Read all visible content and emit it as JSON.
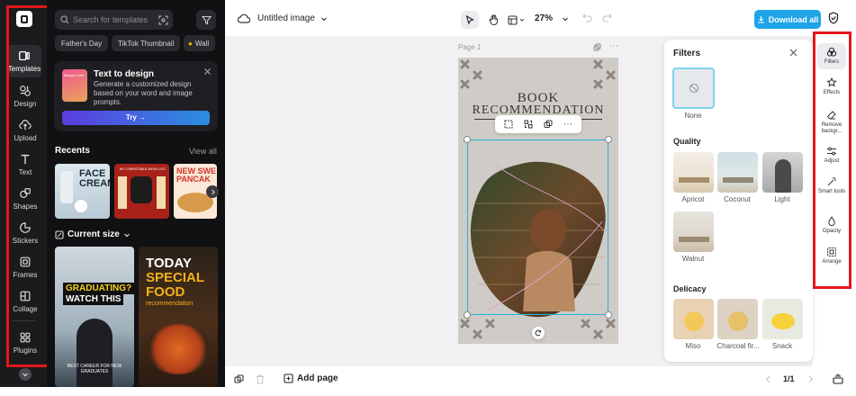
{
  "leftnav": {
    "items": [
      {
        "label": "Templates",
        "icon": "templates-icon"
      },
      {
        "label": "Design",
        "icon": "design-icon"
      },
      {
        "label": "Upload",
        "icon": "upload-icon"
      },
      {
        "label": "Text",
        "icon": "text-icon"
      },
      {
        "label": "Shapes",
        "icon": "shapes-icon"
      },
      {
        "label": "Stickers",
        "icon": "stickers-icon"
      },
      {
        "label": "Frames",
        "icon": "frames-icon"
      },
      {
        "label": "Collage",
        "icon": "collage-icon"
      },
      {
        "label": "Plugins",
        "icon": "plugins-icon"
      }
    ]
  },
  "panel": {
    "search_placeholder": "Search for templates",
    "chips": [
      "Father's Day",
      "TikTok Thumbnail",
      "Wall"
    ],
    "promo": {
      "title": "Text to design",
      "body": "Generate a customized design based on your word and image prompts.",
      "button": "Try →",
      "thumb_text": "Beauty Care"
    },
    "recents_title": "Recents",
    "view_all": "View all",
    "recents": [
      "FACE CREAM",
      "MY CHRISTMAS WISH LIST",
      "NEW SWE PANCAK"
    ],
    "size_label": "Current size",
    "templates": [
      {
        "line1": "GRADUATING?",
        "line2": "WATCH THIS",
        "footer": "BEST CAREER FOR NEW GRADUATES"
      },
      {
        "line1": "TODAY",
        "line2": "SPECIAL",
        "line3": "FOOD",
        "footer": "recommendation"
      }
    ]
  },
  "topbar": {
    "doc_title": "Untitled image",
    "zoom": "27%",
    "download_label": "Download all"
  },
  "canvas": {
    "page_label": "Page 1",
    "design_title_1": "BOOK",
    "design_title_2": "RECOMMENDATION"
  },
  "filters": {
    "title": "Filters",
    "none_label": "None",
    "quality_heading": "Quality",
    "quality": [
      "Apricot",
      "Coconut",
      "Light",
      "Walnut"
    ],
    "delicacy_heading": "Delicacy",
    "delicacy": [
      "Miso",
      "Charcoal fir...",
      "Snack"
    ]
  },
  "rightbar": {
    "items": [
      "Filters",
      "Effects",
      "Remove backgr...",
      "Adjust",
      "Smart tools",
      "Opacity",
      "Arrange"
    ]
  },
  "bottombar": {
    "add_page": "Add page",
    "page_count": "1/1"
  },
  "colors": {
    "accent": "#1fa4e8",
    "selection": "#23b3d9",
    "highlight": "#e4161b"
  }
}
